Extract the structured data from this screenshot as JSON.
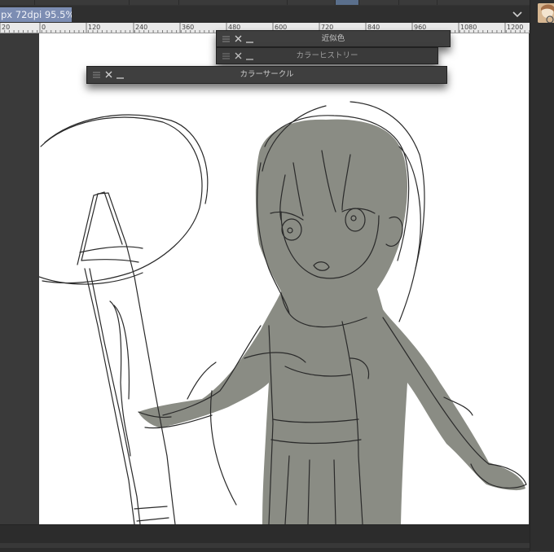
{
  "document_tab": {
    "label": "px 72dpi 95.5%)"
  },
  "ruler": {
    "ticks": [
      "20",
      "0",
      "120",
      "240",
      "360",
      "480",
      "600",
      "720",
      "840",
      "960",
      "1080",
      "1200"
    ]
  },
  "panels": [
    {
      "id": "similar-colors",
      "title": "近似色"
    },
    {
      "id": "color-history",
      "title": "カラーヒストリー"
    },
    {
      "id": "color-wheel",
      "title": "カラーサークル"
    }
  ],
  "colors": {
    "accent": "#7c8db3",
    "canvas": "#ffffff",
    "fill": "#8a8c84",
    "panel": "#3f3f3f"
  },
  "icons": {
    "menu": "hamburger-icon",
    "close": "close-icon",
    "minimize": "minimize-icon",
    "tab_menu": "chevron-down-icon"
  }
}
